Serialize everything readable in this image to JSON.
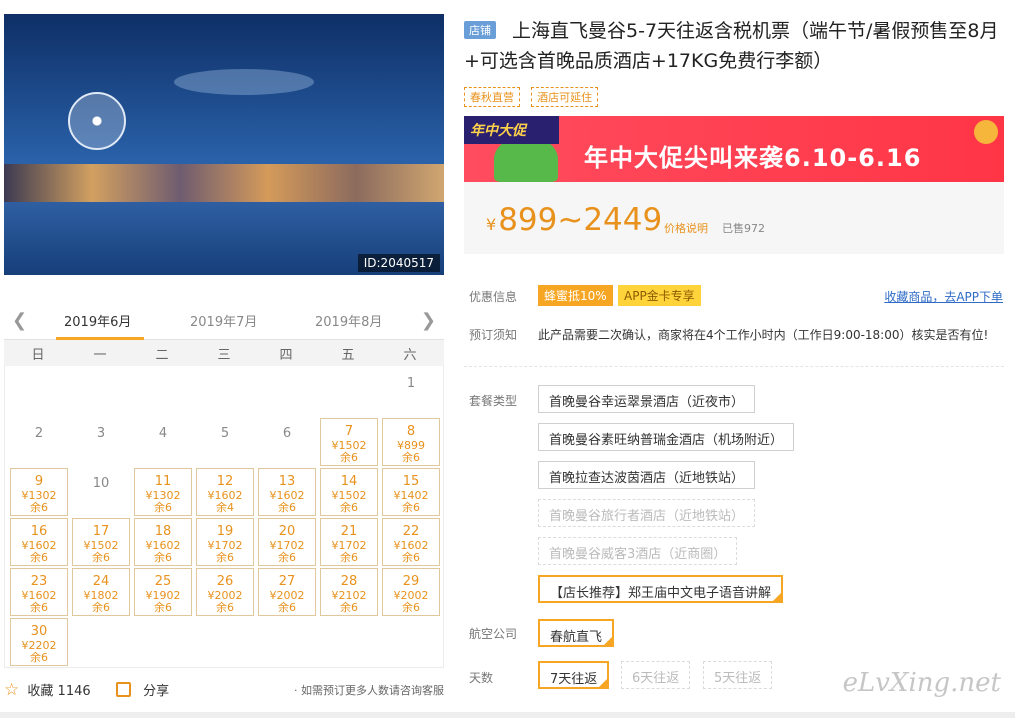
{
  "hero": {
    "id_label": "ID:2040517"
  },
  "calendar": {
    "months": [
      "2019年6月",
      "2019年7月",
      "2019年8月"
    ],
    "weekdays": [
      "日",
      "一",
      "二",
      "三",
      "四",
      "五",
      "六"
    ],
    "days": [
      {
        "d": "1"
      },
      {
        "d": "2"
      },
      {
        "d": "3"
      },
      {
        "d": "4"
      },
      {
        "d": "5"
      },
      {
        "d": "6"
      },
      {
        "d": "7",
        "p": "¥1502",
        "r": "余6"
      },
      {
        "d": "8",
        "p": "¥899",
        "r": "余6"
      },
      {
        "d": "9",
        "p": "¥1302",
        "r": "余6"
      },
      {
        "d": "10"
      },
      {
        "d": "11",
        "p": "¥1302",
        "r": "余6"
      },
      {
        "d": "12",
        "p": "¥1602",
        "r": "余4"
      },
      {
        "d": "13",
        "p": "¥1602",
        "r": "余6"
      },
      {
        "d": "14",
        "p": "¥1502",
        "r": "余6"
      },
      {
        "d": "15",
        "p": "¥1402",
        "r": "余6"
      },
      {
        "d": "16",
        "p": "¥1602",
        "r": "余6"
      },
      {
        "d": "17",
        "p": "¥1502",
        "r": "余6"
      },
      {
        "d": "18",
        "p": "¥1602",
        "r": "余6"
      },
      {
        "d": "19",
        "p": "¥1702",
        "r": "余6"
      },
      {
        "d": "20",
        "p": "¥1702",
        "r": "余6"
      },
      {
        "d": "21",
        "p": "¥1702",
        "r": "余6"
      },
      {
        "d": "22",
        "p": "¥1602",
        "r": "余6"
      },
      {
        "d": "23",
        "p": "¥1602",
        "r": "余6"
      },
      {
        "d": "24",
        "p": "¥1802",
        "r": "余6"
      },
      {
        "d": "25",
        "p": "¥1902",
        "r": "余6"
      },
      {
        "d": "26",
        "p": "¥2002",
        "r": "余6"
      },
      {
        "d": "27",
        "p": "¥2002",
        "r": "余6"
      },
      {
        "d": "28",
        "p": "¥2102",
        "r": "余6"
      },
      {
        "d": "29",
        "p": "¥2002",
        "r": "余6"
      },
      {
        "d": "30",
        "p": "¥2202",
        "r": "余6"
      }
    ],
    "first_weekday": 6
  },
  "footer": {
    "fav_label": "收藏",
    "fav_count": "1146",
    "share_label": "分享",
    "note": "· 如需预订更多人数请咨询客服"
  },
  "product": {
    "store_tag": "店铺",
    "title": "上海直飞曼谷5-7天往返含税机票（端午节/暑假预售至8月+可选含首晚品质酒店+17KG免费行李额）",
    "badges": [
      "春秋直营",
      "酒店可延住"
    ]
  },
  "banner": {
    "tag": "年中大促",
    "text": "年中大促尖叫来袭6.10-6.16"
  },
  "price": {
    "currency": "¥",
    "range": "899~2449",
    "note": "价格说明",
    "sold": "已售972"
  },
  "info": {
    "discount_label": "优惠信息",
    "coupons": [
      "蜂蜜抵10%",
      "APP金卡专享"
    ],
    "fav_link": "收藏商品，去APP下单",
    "notice_label": "预订须知",
    "notice": "此产品需要二次确认，商家将在4个工作小时内（工作日9:00-18:00）核实是否有位!"
  },
  "packages": {
    "label": "套餐类型",
    "items": [
      {
        "label": "首晚曼谷幸运翠景酒店（近夜市）",
        "state": "normal"
      },
      {
        "label": "首晚曼谷素旺纳普瑞金酒店（机场附近）",
        "state": "normal"
      },
      {
        "label": "首晚拉查达波茵酒店（近地铁站）",
        "state": "normal"
      },
      {
        "label": "首晚曼谷旅行者酒店（近地铁站）",
        "state": "disabled"
      },
      {
        "label": "首晚曼谷威客3酒店（近商圈）",
        "state": "disabled"
      },
      {
        "label": "【店长推荐】郑王庙中文电子语音讲解",
        "state": "selected"
      }
    ]
  },
  "airline": {
    "label": "航空公司",
    "value": "春航直飞"
  },
  "days": {
    "label": "天数",
    "options": [
      {
        "label": "7天往返",
        "state": "selected"
      },
      {
        "label": "6天往返",
        "state": "disabled"
      },
      {
        "label": "5天往返",
        "state": "disabled"
      }
    ]
  },
  "watermark": "eLvXing.net"
}
